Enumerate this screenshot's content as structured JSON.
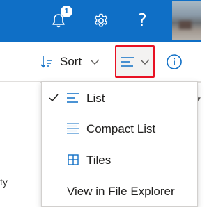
{
  "header": {
    "notifications": {
      "icon": "bell-icon",
      "count": "1"
    },
    "settings": {
      "icon": "gear-icon"
    },
    "help": {
      "icon": "help-icon",
      "glyph": "?"
    },
    "avatar": {
      "icon": "user-avatar"
    },
    "colors": {
      "background": "#0f6fc6",
      "foreground": "#ffffff"
    }
  },
  "command_bar": {
    "sort": {
      "icon": "sort-icon",
      "label": "Sort",
      "chevron": "chevron-down-icon"
    },
    "view_switcher": {
      "icon": "list-view-icon",
      "chevron": "chevron-down-icon",
      "highlight_color": "#e81123"
    },
    "info": {
      "icon": "info-icon"
    },
    "accent": "#0f6fc6"
  },
  "background": {
    "partial_text": "ty"
  },
  "view_menu": {
    "items": [
      {
        "label": "List",
        "icon": "list-icon",
        "selected": true
      },
      {
        "label": "Compact List",
        "icon": "compact-list-icon",
        "selected": false
      },
      {
        "label": "Tiles",
        "icon": "tiles-icon",
        "selected": false
      },
      {
        "label": "View in File Explorer",
        "icon": "",
        "selected": false
      }
    ]
  }
}
